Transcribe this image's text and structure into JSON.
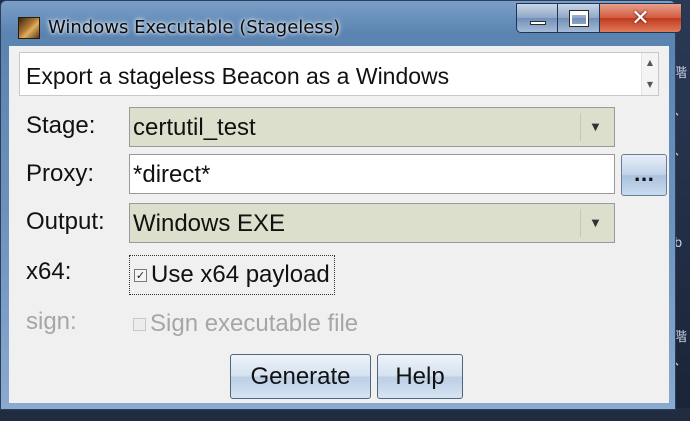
{
  "window": {
    "title": "Windows Executable (Stageless)",
    "close_glyph": "✕"
  },
  "description": "Export a stageless Beacon as a Windows",
  "stage": {
    "label": "Stage:",
    "value": "certutil_test"
  },
  "proxy": {
    "label": "Proxy:",
    "value": "*direct*",
    "browse_label": "..."
  },
  "output": {
    "label": "Output:",
    "value": "Windows EXE"
  },
  "x64": {
    "label": "x64:",
    "checkbox_label": "Use x64 payload",
    "checked": true
  },
  "sign": {
    "label": "sign:",
    "checkbox_label": "Sign executable file",
    "checked": false,
    "enabled": false
  },
  "buttons": {
    "generate": "Generate",
    "help": "Help"
  },
  "background_text": [
    "階",
    "、",
    "、",
    "b",
    "階",
    "、"
  ]
}
